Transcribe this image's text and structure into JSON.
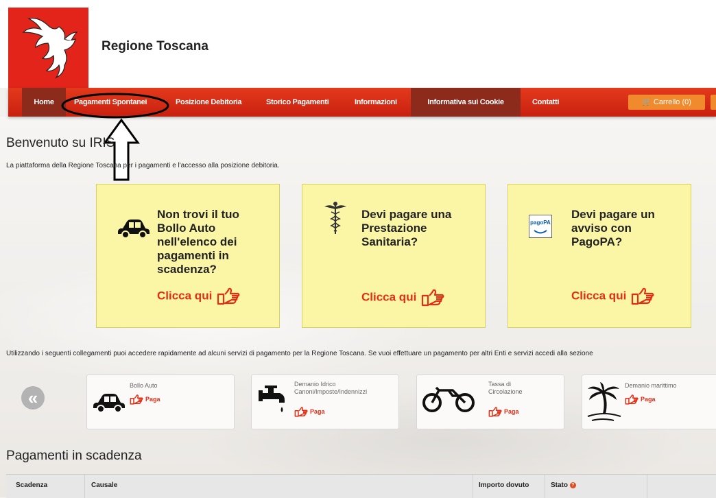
{
  "header": {
    "brand": "Regione Toscana"
  },
  "nav": {
    "items": [
      "Home",
      "Pagamenti Spontanei",
      "Posizione Debitoria",
      "Storico Pagamenti",
      "Informazioni",
      "Informativa sui Cookie",
      "Contatti"
    ],
    "cart": "Carrello (0)"
  },
  "welcome": {
    "title": "Benvenuto su IRIS",
    "subtitle": "La piattaforma della Regione Toscana per i pagamenti e l'accesso alla posizione debitoria."
  },
  "cards": [
    {
      "text": "Non trovi il tuo Bollo Auto nell'elenco dei pagamenti in scadenza?",
      "link": "Clicca qui",
      "icon": "car-icon"
    },
    {
      "text": "Devi pagare una Prestazione Sanitaria?",
      "link": "Clicca qui",
      "icon": "caduceus-icon"
    },
    {
      "text": "Devi pagare un avviso con PagoPA?",
      "link": "Clicca qui",
      "icon": "pagopa-icon",
      "icon_label": "pagoPA"
    }
  ],
  "links_intro": "Utilizzando i seguenti collegamenti puoi accedere rapidamente ad alcuni servizi di pagamento per la Regione Toscana. Se vuoi effettuare un pagamento per altri Enti e servizi accedi alla sezione",
  "services": [
    {
      "name": "Bollo Auto",
      "pay": "Paga",
      "icon": "car-icon"
    },
    {
      "name": "Demanio Idrico Canoni/Imposte/Indennizzi",
      "pay": "Paga",
      "icon": "faucet-icon"
    },
    {
      "name": "Tassa di Circolazione",
      "pay": "Paga",
      "icon": "bicycle-icon"
    },
    {
      "name": "Demanio marittimo",
      "pay": "Paga",
      "icon": "palm-tree-icon"
    }
  ],
  "deadlines": {
    "title": "Pagamenti in scadenza",
    "columns": [
      "Scadenza",
      "Causale",
      "Importo dovuto",
      "Stato"
    ]
  },
  "colors": {
    "nav_red": "#d22a14",
    "card_yellow": "#fbf6a6",
    "link_red": "#e32d14",
    "cart_orange": "#f08a2c"
  }
}
